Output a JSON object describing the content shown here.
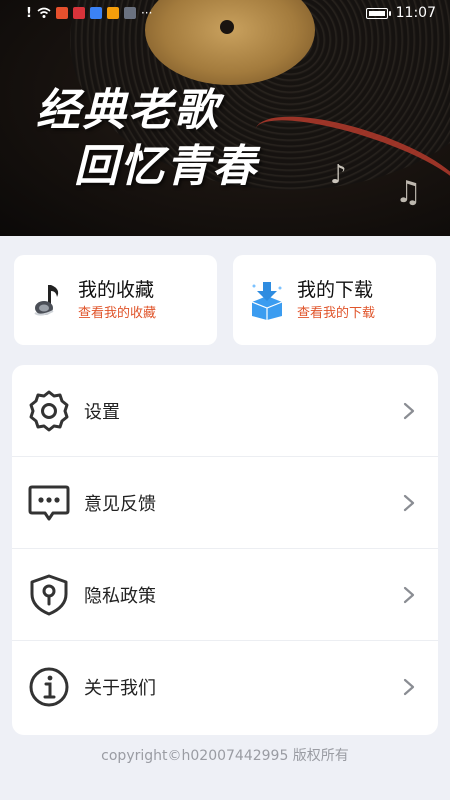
{
  "status_bar": {
    "time": "11:07"
  },
  "banner": {
    "line1": "经典老歌",
    "line2": "回忆青春"
  },
  "quick_cards": [
    {
      "title": "我的收藏",
      "subtitle": "查看我的收藏",
      "icon": "music-note-icon"
    },
    {
      "title": "我的下载",
      "subtitle": "查看我的下载",
      "icon": "download-box-icon"
    }
  ],
  "menu": [
    {
      "label": "设置",
      "icon": "gear-icon"
    },
    {
      "label": "意见反馈",
      "icon": "chat-bubble-icon"
    },
    {
      "label": "隐私政策",
      "icon": "shield-icon"
    },
    {
      "label": "关于我们",
      "icon": "info-icon"
    }
  ],
  "footer": {
    "copyright": "copyright©h02007442995 版权所有"
  },
  "colors": {
    "accent": "#e0552b",
    "background": "#eef0f6",
    "card": "#ffffff"
  }
}
